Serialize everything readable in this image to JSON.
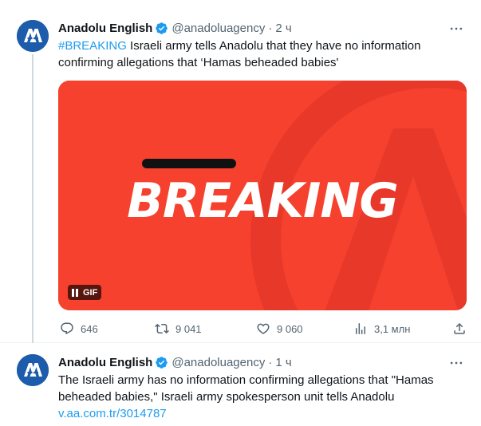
{
  "tweets": [
    {
      "author_name": "Anadolu English",
      "handle": "@anadoluagency",
      "separator": "·",
      "time": "2 ч",
      "text_hashtag": "#BREAKING",
      "text_line1_rest": " Israeli army tells Anadolu that they have no information",
      "text_line2": "confirming allegations that ‘Hamas beheaded babies'",
      "media": {
        "headline": "BREAKING",
        "badge": "GIF",
        "brand_color": "#f5412d"
      },
      "stats": {
        "replies": "646",
        "reposts": "9 041",
        "likes": "9 060",
        "views": "3,1 млн"
      }
    },
    {
      "author_name": "Anadolu English",
      "handle": "@anadoluagency",
      "separator": "·",
      "time": "1 ч",
      "text_line1": "The Israeli army has no information confirming allegations that \"Hamas",
      "text_line2": "beheaded babies,\" Israeli army spokesperson unit tells Anadolu",
      "link": "v.aa.com.tr/3014787"
    }
  ],
  "colors": {
    "accent": "#1d9bf0",
    "secondary_text": "#536471",
    "avatar_bg": "#1c5cab"
  },
  "icons": [
    "verified-badge-icon",
    "more-icon",
    "reply-icon",
    "repost-icon",
    "like-icon",
    "views-icon",
    "share-icon",
    "pause-icon"
  ]
}
